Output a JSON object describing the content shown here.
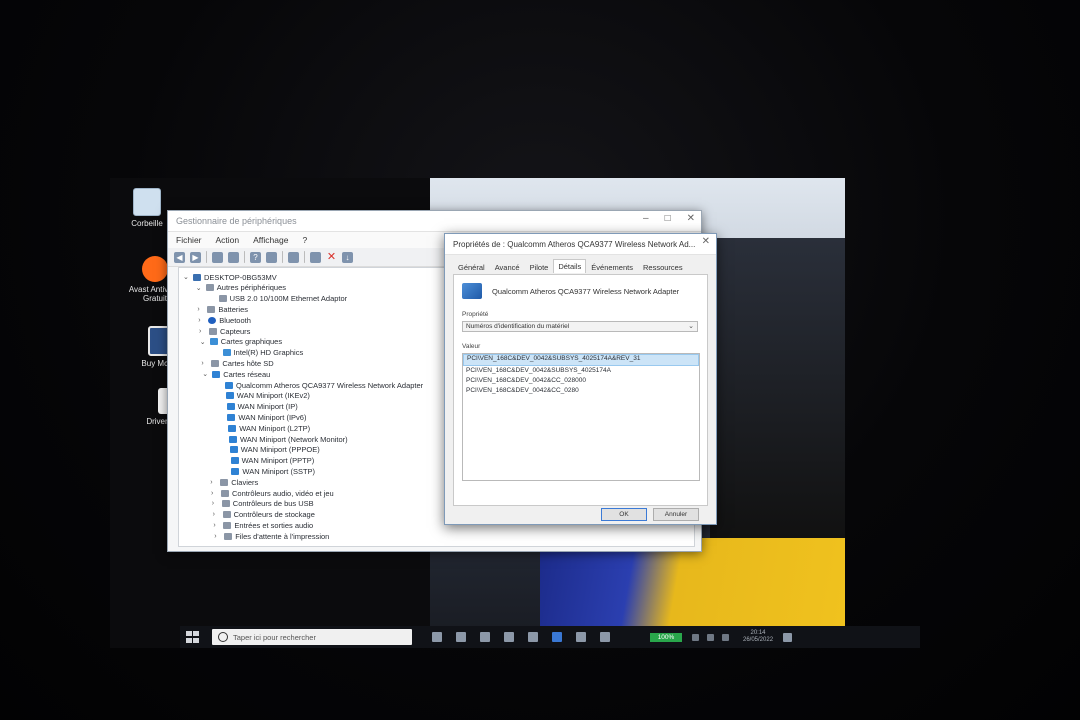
{
  "desktop": {
    "icons": [
      {
        "label": "Corbeille"
      },
      {
        "label": "Avast Antivirus Gratuit"
      },
      {
        "label": "Buy McAfee"
      },
      {
        "label": "Driver Update"
      }
    ]
  },
  "device_manager": {
    "title": "Gestionnaire de périphériques",
    "menu": [
      "Fichier",
      "Action",
      "Affichage",
      "?"
    ],
    "tree": [
      {
        "label": "DESKTOP-0BG53MV",
        "level": 0,
        "expanded": true,
        "icon": "computer-icon"
      },
      {
        "label": "Autres périphériques",
        "level": 1,
        "expanded": true,
        "icon": "unknown-device-icon"
      },
      {
        "label": "USB 2.0 10/100M Ethernet Adaptor",
        "level": 2,
        "icon": "warning-device-icon"
      },
      {
        "label": "Batteries",
        "level": 1,
        "expanded": false,
        "icon": "battery-icon"
      },
      {
        "label": "Bluetooth",
        "level": 1,
        "expanded": false,
        "icon": "bluetooth-icon"
      },
      {
        "label": "Capteurs",
        "level": 1,
        "expanded": false,
        "icon": "sensor-icon"
      },
      {
        "label": "Cartes graphiques",
        "level": 1,
        "expanded": true,
        "icon": "display-adapter-icon"
      },
      {
        "label": "Intel(R) HD Graphics",
        "level": 2,
        "icon": "display-adapter-icon"
      },
      {
        "label": "Cartes hôte SD",
        "level": 1,
        "expanded": false,
        "icon": "sd-host-icon"
      },
      {
        "label": "Cartes réseau",
        "level": 1,
        "expanded": true,
        "icon": "network-adapter-icon"
      },
      {
        "label": "Qualcomm Atheros QCA9377 Wireless Network Adapter",
        "level": 2,
        "icon": "network-adapter-icon"
      },
      {
        "label": "WAN Miniport (IKEv2)",
        "level": 2,
        "icon": "network-adapter-icon"
      },
      {
        "label": "WAN Miniport (IP)",
        "level": 2,
        "icon": "network-adapter-icon"
      },
      {
        "label": "WAN Miniport (IPv6)",
        "level": 2,
        "icon": "network-adapter-icon"
      },
      {
        "label": "WAN Miniport (L2TP)",
        "level": 2,
        "icon": "network-adapter-icon"
      },
      {
        "label": "WAN Miniport (Network Monitor)",
        "level": 2,
        "icon": "network-adapter-icon"
      },
      {
        "label": "WAN Miniport (PPPOE)",
        "level": 2,
        "icon": "network-adapter-icon"
      },
      {
        "label": "WAN Miniport (PPTP)",
        "level": 2,
        "icon": "network-adapter-icon"
      },
      {
        "label": "WAN Miniport (SSTP)",
        "level": 2,
        "icon": "network-adapter-icon"
      },
      {
        "label": "Claviers",
        "level": 1,
        "expanded": false,
        "icon": "keyboard-icon"
      },
      {
        "label": "Contrôleurs audio, vidéo et jeu",
        "level": 1,
        "expanded": false,
        "icon": "audio-icon"
      },
      {
        "label": "Contrôleurs de bus USB",
        "level": 1,
        "expanded": false,
        "icon": "usb-icon"
      },
      {
        "label": "Contrôleurs de stockage",
        "level": 1,
        "expanded": false,
        "icon": "storage-icon"
      },
      {
        "label": "Entrées et sorties audio",
        "level": 1,
        "expanded": false,
        "icon": "audio-icon"
      },
      {
        "label": "Files d'attente à l'impression",
        "level": 1,
        "expanded": false,
        "icon": "printer-icon"
      }
    ]
  },
  "properties": {
    "title": "Propriétés de : Qualcomm Atheros QCA9377 Wireless Network Ad...",
    "tabs": [
      "Général",
      "Avancé",
      "Pilote",
      "Détails",
      "Événements",
      "Ressources"
    ],
    "active_tab": "Détails",
    "device_name": "Qualcomm Atheros QCA9377 Wireless Network Adapter",
    "property_label": "Propriété",
    "property_value": "Numéros d'identification du matériel",
    "value_label": "Valeur",
    "values": [
      "PCI\\VEN_168C&DEV_0042&SUBSYS_4025174A&REV_31",
      "PCI\\VEN_168C&DEV_0042&SUBSYS_4025174A",
      "PCI\\VEN_168C&DEV_0042&CC_028000",
      "PCI\\VEN_168C&DEV_0042&CC_0280"
    ],
    "ok_label": "OK",
    "cancel_label": "Annuler"
  },
  "taskbar": {
    "search_placeholder": "Taper ici pour rechercher",
    "battery": "100%",
    "clock": "20:14",
    "date": "26/05/2022"
  }
}
